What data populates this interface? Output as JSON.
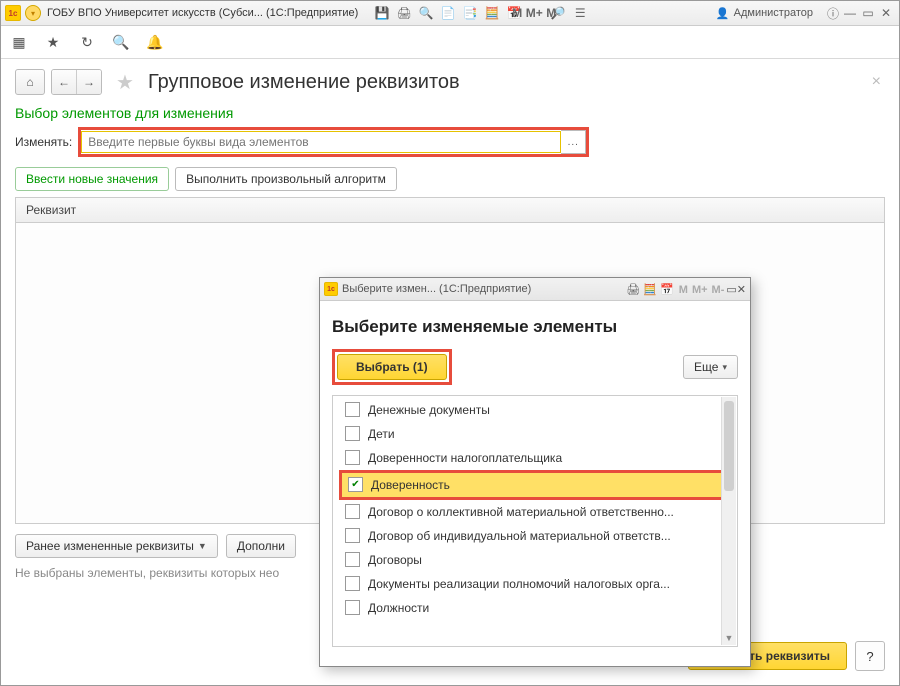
{
  "titlebar": {
    "app_title": "ГОБУ ВПО Университет искусств (Субси... (1С:Предприятие)",
    "user": "Администратор"
  },
  "page": {
    "title": "Групповое изменение реквизитов",
    "section": "Выбор элементов для изменения",
    "change_label": "Изменять:",
    "placeholder": "Введите первые буквы вида элементов",
    "tab_new": "Ввести новые значения",
    "tab_script": "Выполнить произвольный алгоритм",
    "grid_header": "Реквизит",
    "btn_prev": "Ранее измененные реквизиты",
    "btn_add": "Дополни",
    "hint": "Не выбраны элементы, реквизиты которых нео",
    "btn_change": "Изменить реквизиты",
    "help": "?"
  },
  "modal": {
    "win_title": "Выберите измен... (1С:Предприятие)",
    "heading": "Выберите изменяемые элементы",
    "btn_select": "Выбрать (1)",
    "btn_more": "Еще",
    "items": [
      {
        "label": "Денежные документы",
        "checked": false
      },
      {
        "label": "Дети",
        "checked": false
      },
      {
        "label": "Доверенности налогоплательщика",
        "checked": false
      },
      {
        "label": "Доверенность",
        "checked": true
      },
      {
        "label": "Договор о коллективной материальной ответственно...",
        "checked": false
      },
      {
        "label": "Договор об индивидуальной материальной ответств...",
        "checked": false
      },
      {
        "label": "Договоры",
        "checked": false
      },
      {
        "label": "Документы реализации полномочий налоговых орга...",
        "checked": false
      },
      {
        "label": "Должности",
        "checked": false
      }
    ]
  }
}
